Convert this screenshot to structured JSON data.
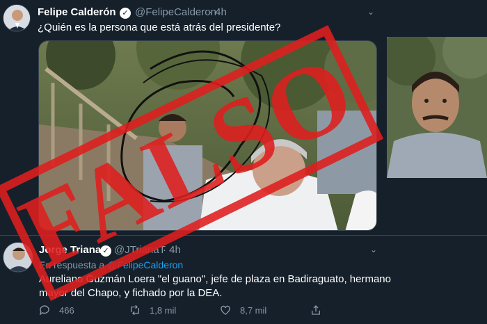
{
  "tweet": {
    "author_name": "Felipe Calderón",
    "author_handle": "@FelipeCalderon",
    "time": "· 4h",
    "text": "¿Quién es la persona que está atrás del presidente?"
  },
  "reply": {
    "author_name": "Jorge Triana",
    "author_handle": "@JTrianaT",
    "time": "· 4h",
    "in_reply_prefix": "En respuesta a",
    "in_reply_handle": "@FelipeCalderon",
    "text_line1": "Aureliano Guzmán Loera \"el guano\", jefe de plaza en Badiraguato, hermano",
    "text_line2": "mayor del Chapo, y fichado por la DEA."
  },
  "actions": {
    "reply_count": "466",
    "retweet_count": "1,8 mil",
    "like_count": "8,7 mil"
  },
  "stamp": {
    "text": "FALSO",
    "color": "#e01e1e"
  },
  "colors": {
    "background": "#15202b",
    "secondary_text": "#8899a6",
    "link": "#1da1f2"
  },
  "icons": {
    "verified": "verified-badge-icon",
    "chevron": "chevron-down-icon",
    "reply": "reply-icon",
    "retweet": "retweet-icon",
    "like": "heart-icon",
    "share": "share-icon"
  }
}
